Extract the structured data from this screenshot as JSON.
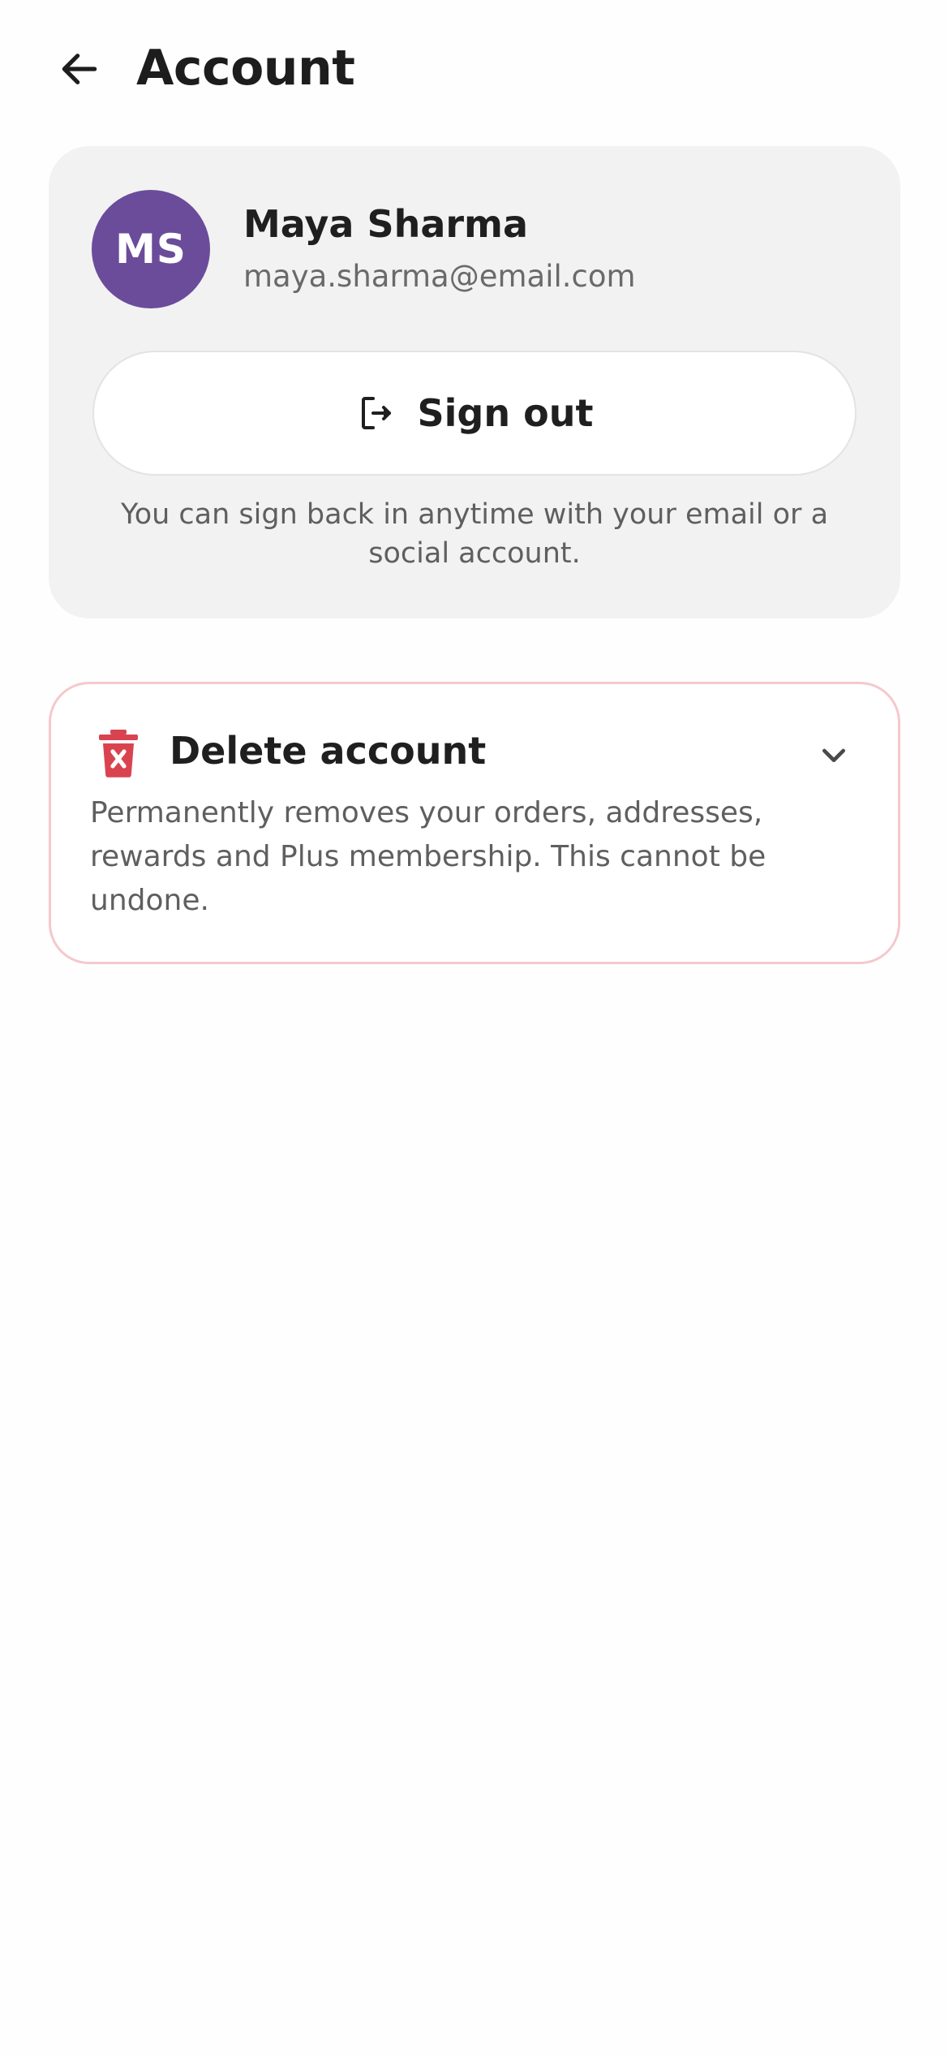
{
  "header": {
    "title": "Account",
    "back_icon": "arrow-left-icon"
  },
  "profile": {
    "initials": "MS",
    "name": "Maya Sharma",
    "email": "maya.sharma@email.com",
    "avatar_color": "#6b4c9a",
    "signout_label": "Sign out",
    "signout_icon": "sign-out-icon",
    "note": "You can sign back in anytime with your email or a social account."
  },
  "delete": {
    "title": "Delete account",
    "description": "Permanently removes your orders, addresses, rewards and Plus membership. This cannot be undone.",
    "icon": "trash-icon",
    "chevron_icon": "chevron-down-icon",
    "accent_color": "#d9434f",
    "border_color": "#f5c8cc"
  }
}
